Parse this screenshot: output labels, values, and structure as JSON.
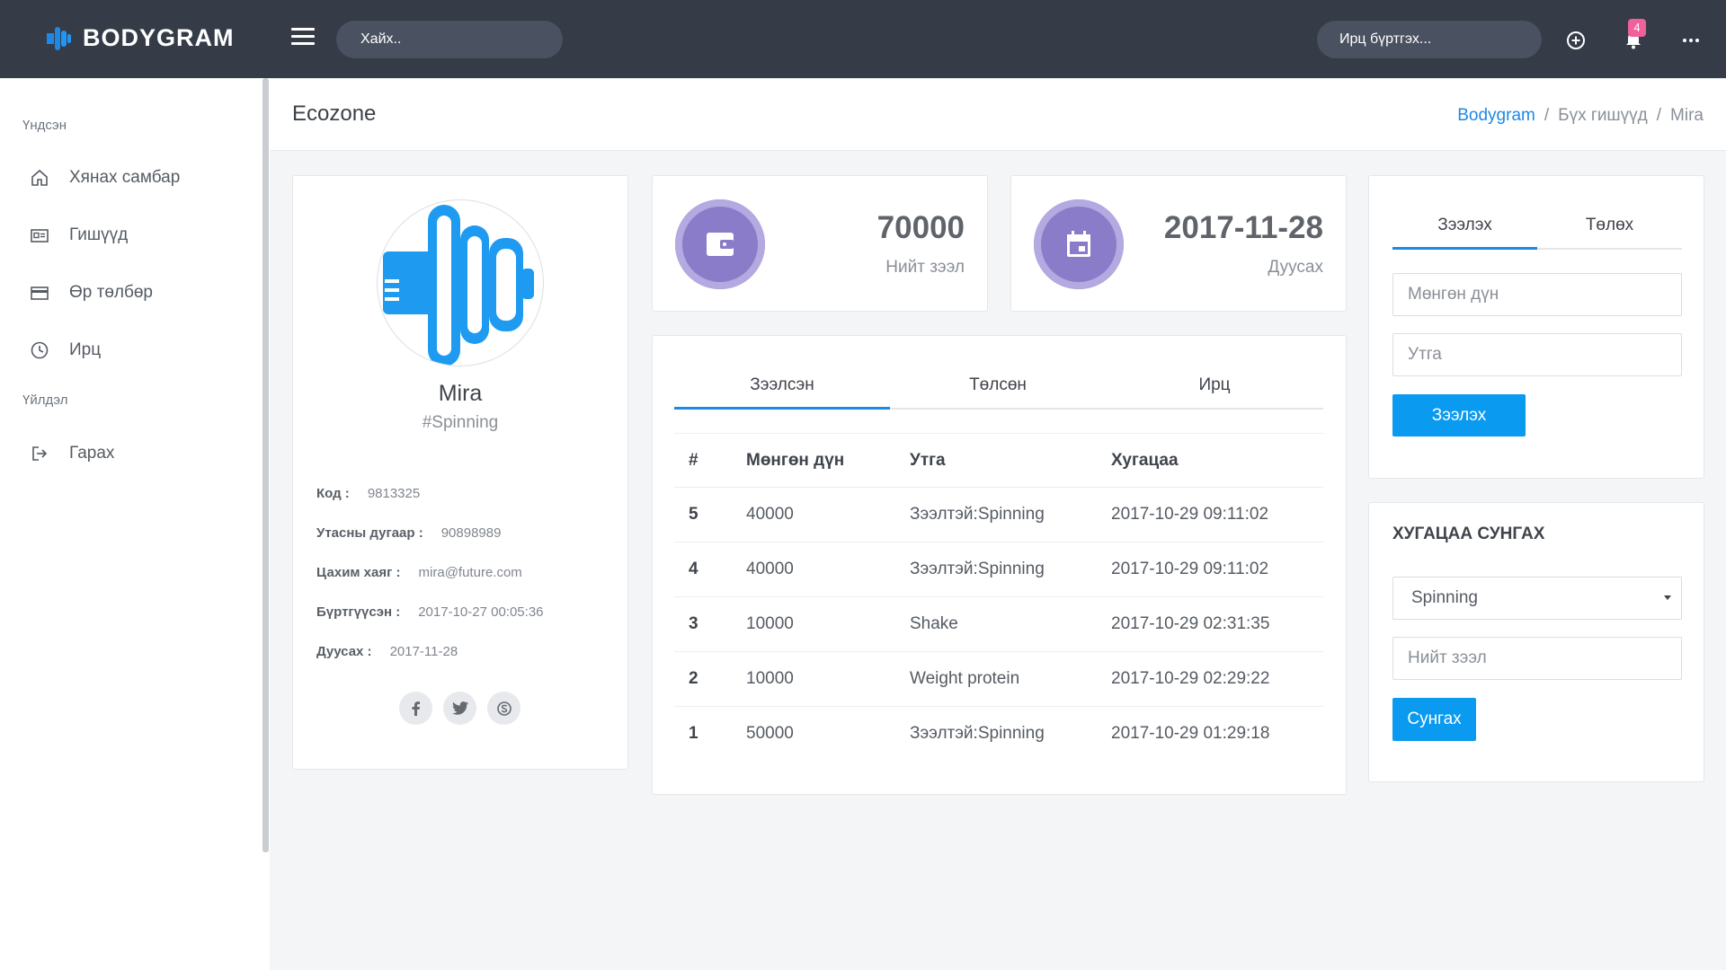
{
  "brand": {
    "name": "BODYGRAM"
  },
  "topbar": {
    "search_placeholder": "Хайх..",
    "attendance_placeholder": "Ирц бүртгэх...",
    "notification_count": "4"
  },
  "sidebar": {
    "section_main": "Үндсэн",
    "section_action": "Үйлдэл",
    "items": [
      {
        "label": "Хянах самбар",
        "icon": "home-icon"
      },
      {
        "label": "Гишүүд",
        "icon": "id-card-icon"
      },
      {
        "label": "Өр төлбөр",
        "icon": "credit-card-icon"
      },
      {
        "label": "Ирц",
        "icon": "clock-icon"
      }
    ],
    "logout_label": "Гарах"
  },
  "header": {
    "title": "Ecozone",
    "breadcrumb": [
      "Bodygram",
      "Бүх гишүүд",
      "Mira"
    ],
    "separator": "/"
  },
  "profile": {
    "name": "Mira",
    "tag": "#Spinning",
    "fields": [
      {
        "label": "Код :",
        "value": "9813325"
      },
      {
        "label": "Утасны дугаар :",
        "value": "90898989"
      },
      {
        "label": "Цахим хаяг :",
        "value": "mira@future.com"
      },
      {
        "label": "Бүртгүүсэн :",
        "value": "2017-10-27 00:05:36"
      },
      {
        "label": "Дуусах :",
        "value": "2017-11-28"
      }
    ],
    "socials": [
      "facebook-icon",
      "twitter-icon",
      "skype-icon"
    ]
  },
  "stats": [
    {
      "value": "70000",
      "label": "Нийт зээл",
      "icon": "wallet-icon"
    },
    {
      "value": "2017-11-28",
      "label": "Дуусах",
      "icon": "calendar-icon"
    }
  ],
  "history": {
    "tabs": [
      "Зээлсэн",
      "Төлсөн",
      "Ирц"
    ],
    "columns": [
      "#",
      "Мөнгөн дүн",
      "Утга",
      "Хугацаа"
    ],
    "rows": [
      [
        "5",
        "40000",
        "Зээлтэй:Spinning",
        "2017-10-29 09:11:02"
      ],
      [
        "4",
        "40000",
        "Зээлтэй:Spinning",
        "2017-10-29 09:11:02"
      ],
      [
        "3",
        "10000",
        "Shake",
        "2017-10-29 02:31:35"
      ],
      [
        "2",
        "10000",
        "Weight protein",
        "2017-10-29 02:29:22"
      ],
      [
        "1",
        "50000",
        "Зээлтэй:Spinning",
        "2017-10-29 01:29:18"
      ]
    ]
  },
  "loan_form": {
    "tabs": [
      "Зээлэх",
      "Төлөх"
    ],
    "amount_placeholder": "Мөнгөн дүн",
    "note_placeholder": "Утга",
    "submit_label": "Зээлэх"
  },
  "extend_form": {
    "title": "ХУГАЦАА СУНГАХ",
    "selected_option": "Spinning",
    "total_placeholder": "Нийт зээл",
    "submit_label": "Сунгах"
  },
  "colors": {
    "topbar": "#353c48",
    "accent": "#1e88e5",
    "button": "#0a9af0",
    "stat_circle": "#8a7cc8",
    "badge": "#f0609a"
  }
}
